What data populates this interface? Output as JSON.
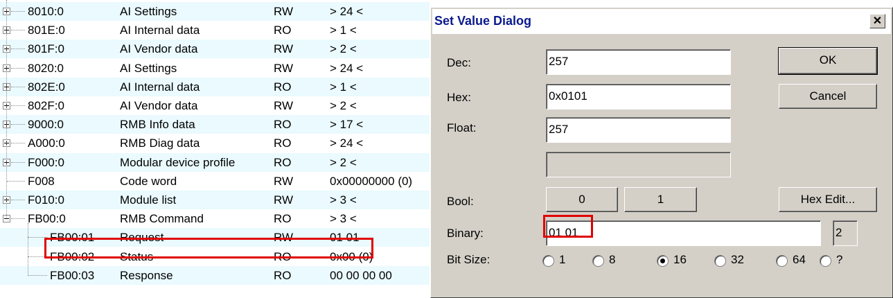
{
  "tree": {
    "rows": [
      {
        "index": "8010:0",
        "name": "AI Settings",
        "flags": "RW",
        "value": "> 24 <",
        "type": "collapsed"
      },
      {
        "index": "801E:0",
        "name": "AI Internal data",
        "flags": "RO",
        "value": "> 1 <",
        "type": "collapsed"
      },
      {
        "index": "801F:0",
        "name": "AI Vendor data",
        "flags": "RW",
        "value": "> 2 <",
        "type": "collapsed"
      },
      {
        "index": "8020:0",
        "name": "AI Settings",
        "flags": "RW",
        "value": "> 24 <",
        "type": "collapsed"
      },
      {
        "index": "802E:0",
        "name": "AI Internal data",
        "flags": "RO",
        "value": "> 1 <",
        "type": "collapsed"
      },
      {
        "index": "802F:0",
        "name": "AI Vendor data",
        "flags": "RW",
        "value": "> 2 <",
        "type": "collapsed"
      },
      {
        "index": "9000:0",
        "name": "RMB Info data",
        "flags": "RO",
        "value": "> 17 <",
        "type": "collapsed"
      },
      {
        "index": "A000:0",
        "name": "RMB Diag data",
        "flags": "RO",
        "value": "> 24 <",
        "type": "collapsed"
      },
      {
        "index": "F000:0",
        "name": "Modular device profile",
        "flags": "RO",
        "value": "> 2 <",
        "type": "collapsed"
      },
      {
        "index": "F008",
        "name": "Code word",
        "flags": "RW",
        "value": "0x00000000 (0)",
        "type": "leaf"
      },
      {
        "index": "F010:0",
        "name": "Module list",
        "flags": "RW",
        "value": "> 3 <",
        "type": "collapsed"
      },
      {
        "index": "FB00:0",
        "name": "RMB Command",
        "flags": "RO",
        "value": "> 3 <",
        "type": "expanded"
      },
      {
        "index": "FB00:01",
        "name": "Request",
        "flags": "RW",
        "value": "01 01",
        "type": "child"
      },
      {
        "index": "FB00:02",
        "name": "Status",
        "flags": "RO",
        "value": "0x00 (0)",
        "type": "child"
      },
      {
        "index": "FB00:03",
        "name": "Response",
        "flags": "RO",
        "value": "00 00 00 00",
        "type": "child"
      }
    ]
  },
  "dialog": {
    "title": "Set Value Dialog",
    "close_label": "✕",
    "dec_label": "Dec:",
    "dec_value": "257",
    "hex_label": "Hex:",
    "hex_value": "0x0101",
    "float_label": "Float:",
    "float_value": "257",
    "extra_value": "",
    "bool_label": "Bool:",
    "bool_false": "0",
    "bool_true": "1",
    "binary_label": "Binary:",
    "binary_value": "01 01",
    "byte_count": "2",
    "bitsize_label": "Bit Size:",
    "bitsize_options": [
      "1",
      "8",
      "16",
      "32",
      "64",
      "?"
    ],
    "bitsize_selected": "16",
    "ok_label": "OK",
    "cancel_label": "Cancel",
    "hexedit_label": "Hex Edit..."
  },
  "colors": {
    "row_shade": "#eafaff",
    "highlight": "#e00000",
    "dialog_bg": "#d4d0c8",
    "title_text": "#0a1a8c"
  }
}
